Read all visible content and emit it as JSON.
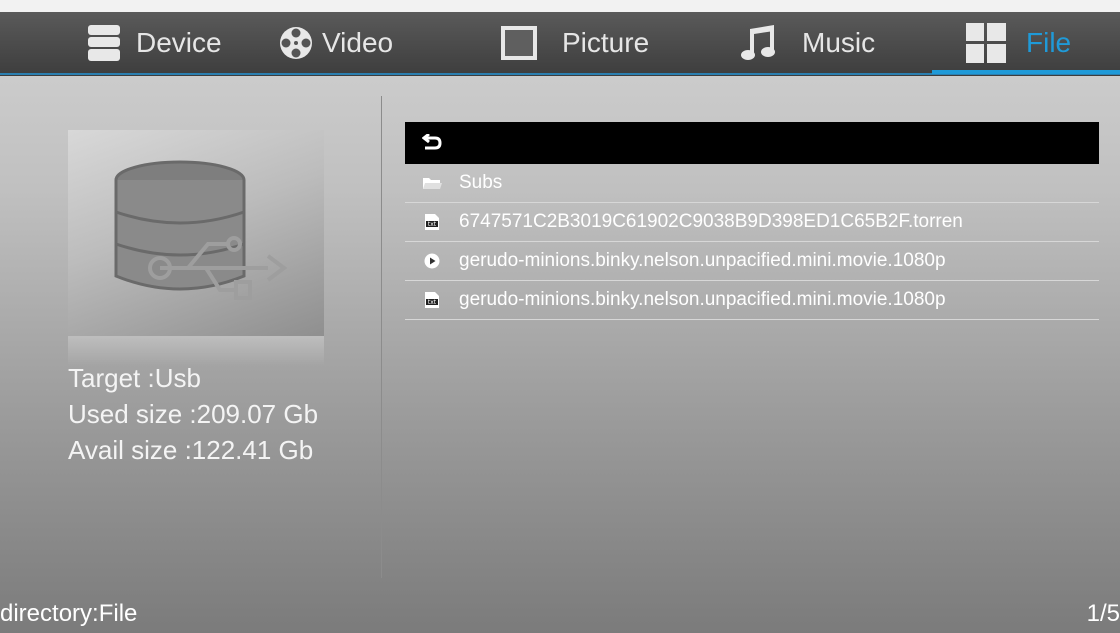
{
  "tabs": [
    {
      "label": "Device",
      "icon": "database-icon"
    },
    {
      "label": "Video",
      "icon": "film-reel-icon"
    },
    {
      "label": "Picture",
      "icon": "picture-icon"
    },
    {
      "label": "Music",
      "icon": "music-note-icon"
    },
    {
      "label": "File",
      "icon": "grid-icon",
      "active": true
    }
  ],
  "colors": {
    "accent": "#1f9ad8",
    "selected_row": "#000000"
  },
  "device": {
    "target": "Target :Usb",
    "used": "Used size :209.07 Gb",
    "avail": "Avail size :122.41 Gb"
  },
  "files": [
    {
      "label": "",
      "icon": "back-arrow-icon"
    },
    {
      "label": "Subs",
      "icon": "folder-icon"
    },
    {
      "label": "6747571C2B3019C61902C9038B9D398ED1C65B2F.torren",
      "icon": "txt-file-icon"
    },
    {
      "label": "gerudo-minions.binky.nelson.unpacified.mini.movie.1080p",
      "icon": "play-icon"
    },
    {
      "label": "gerudo-minions.binky.nelson.unpacified.mini.movie.1080p",
      "icon": "txt-file-icon"
    }
  ],
  "footer": {
    "directory": "directory:File",
    "page": "1/5"
  }
}
